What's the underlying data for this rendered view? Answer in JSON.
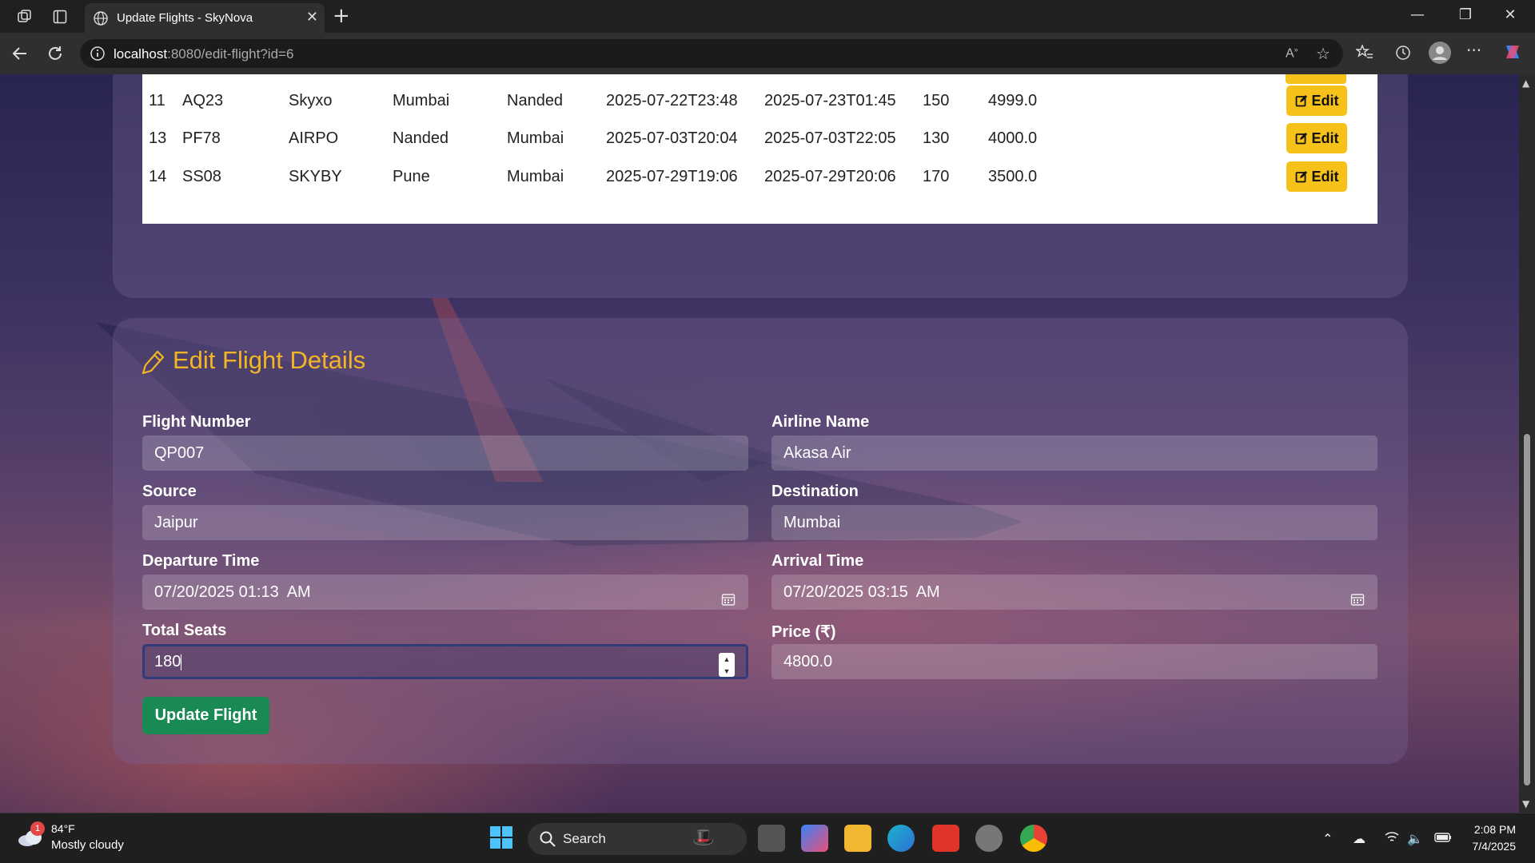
{
  "browser": {
    "tab_title": "Update Flights - SkyNova",
    "url_host": "localhost",
    "url_rest": ":8080/edit-flight?id=6"
  },
  "flights_table": {
    "edit_label": "Edit",
    "rows": [
      [
        "11",
        "AQ23",
        "Skyxo",
        "Mumbai",
        "Nanded",
        "2025-07-22T23:48",
        "2025-07-23T01:45",
        "150",
        "4999.0"
      ],
      [
        "13",
        "PF78",
        "AIRPO",
        "Nanded",
        "Mumbai",
        "2025-07-03T20:04",
        "2025-07-03T22:05",
        "130",
        "4000.0"
      ],
      [
        "14",
        "SS08",
        "SKYBY",
        "Pune",
        "Mumbai",
        "2025-07-29T19:06",
        "2025-07-29T20:06",
        "170",
        "3500.0"
      ]
    ]
  },
  "edit_form": {
    "title": "Edit Flight Details",
    "flight_number_label": "Flight Number",
    "flight_number_value": "QP007",
    "airline_label": "Airline Name",
    "airline_value": "Akasa Air",
    "source_label": "Source",
    "source_value": "Jaipur",
    "destination_label": "Destination",
    "destination_value": "Mumbai",
    "departure_label": "Departure Time",
    "departure_value": "07/20/2025 01:13  AM",
    "arrival_label": "Arrival Time",
    "arrival_value": "07/20/2025 03:15  AM",
    "seats_label": "Total Seats",
    "seats_value": "180",
    "price_label": "Price (₹)",
    "price_value": "4800.0",
    "submit_label": "Update Flight"
  },
  "taskbar": {
    "weather_temp": "84°F",
    "weather_desc": "Mostly cloudy",
    "weather_badge": "1",
    "search_label": "Search",
    "time": "2:08 PM",
    "date": "7/4/2025"
  },
  "colors": {
    "accent_yellow": "#f6c21a",
    "title_gold": "#f3b523",
    "update_green": "#1a8a55"
  }
}
